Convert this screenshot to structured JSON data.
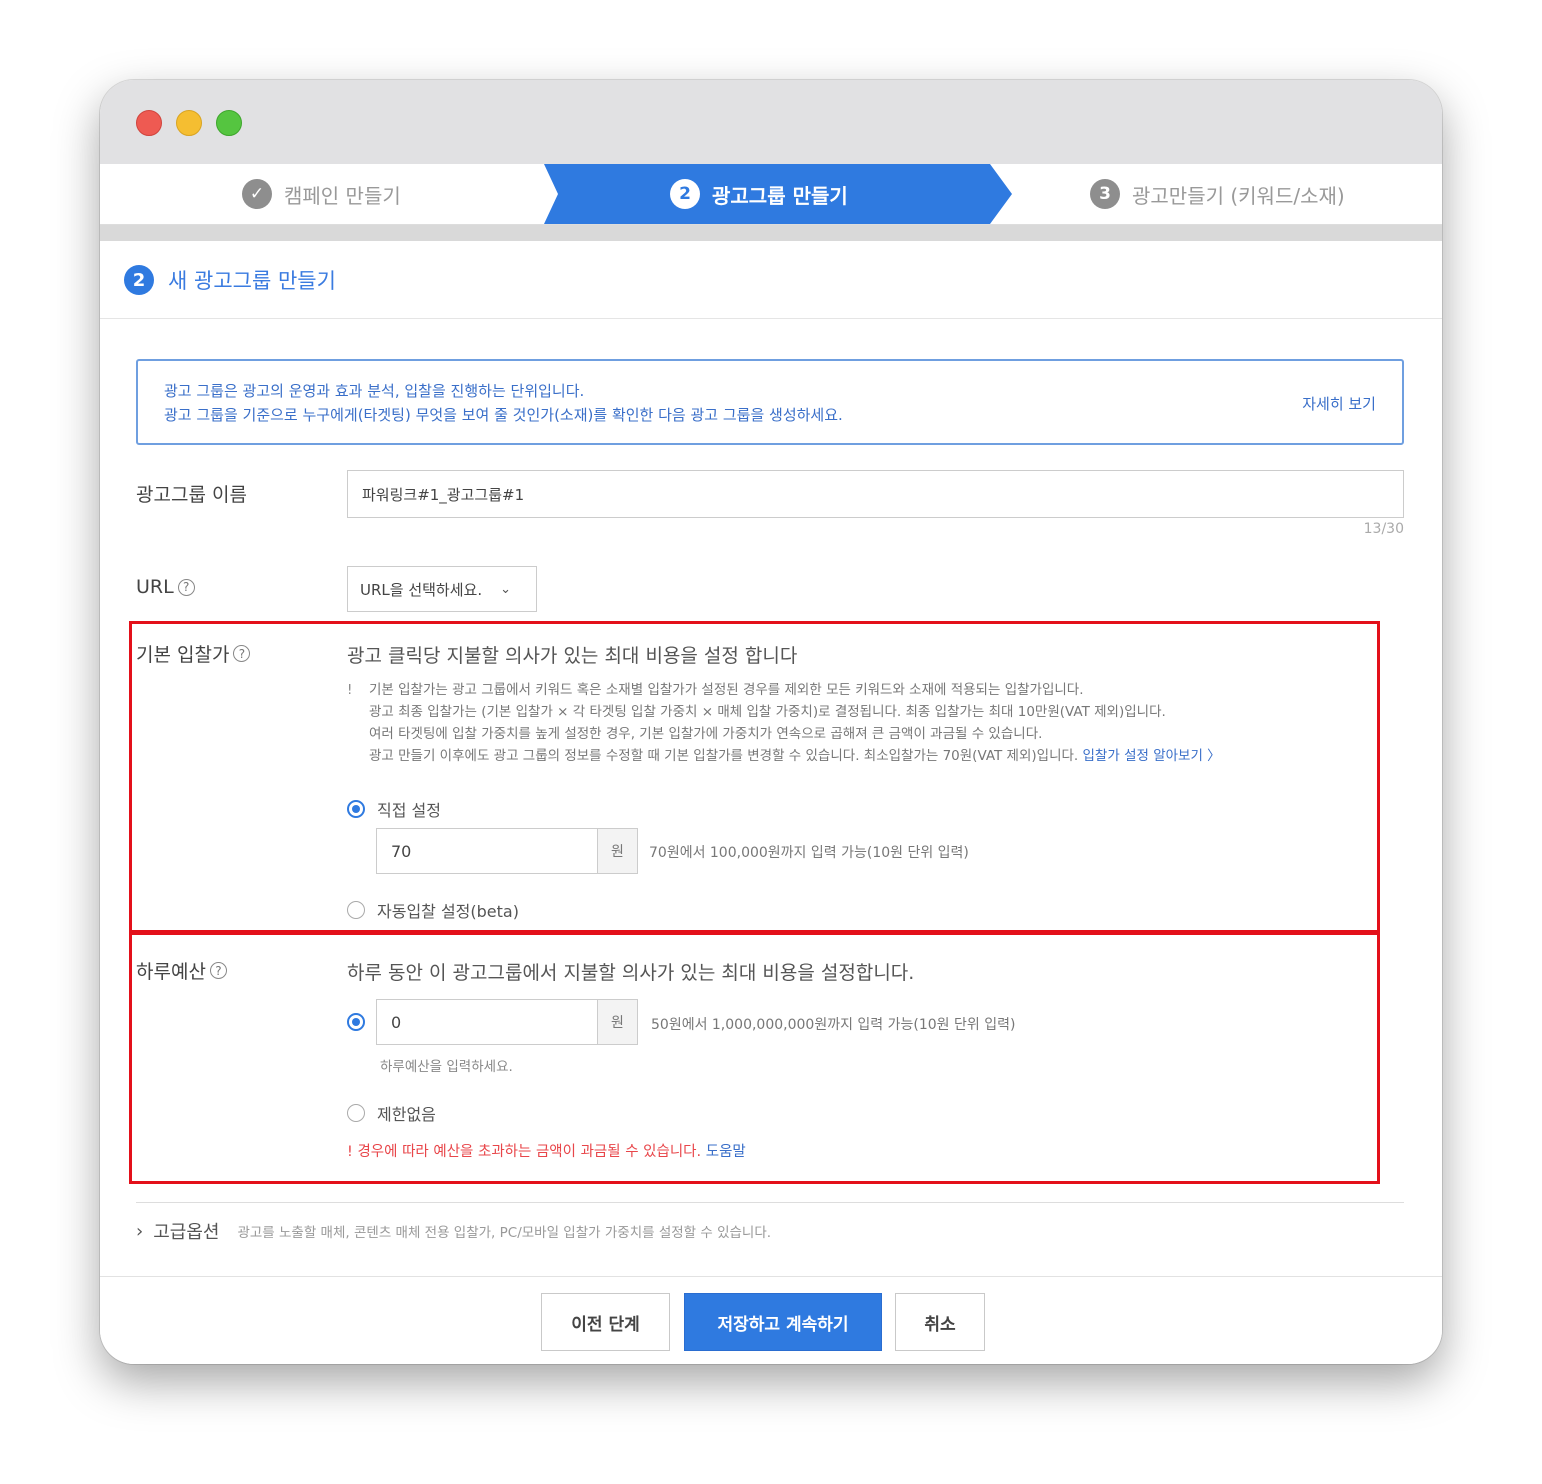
{
  "window": {
    "controls": [
      "close",
      "minimize",
      "maximize"
    ]
  },
  "steps": [
    {
      "label": "캠페인 만들기",
      "icon": "check-icon",
      "state": "done"
    },
    {
      "label": "광고그룹 만들기",
      "number": "2",
      "state": "active"
    },
    {
      "label": "광고만들기 (키워드/소재)",
      "number": "3",
      "state": "pending"
    }
  ],
  "section": {
    "number": "2",
    "title": "새 광고그룹 만들기"
  },
  "info": {
    "line1": "광고 그룹은 광고의 운영과 효과 분석, 입찰을 진행하는 단위입니다.",
    "line2": "광고 그룹을 기준으로 누구에게(타겟팅) 무엇을 보여 줄 것인가(소재)를 확인한 다음 광고 그룹을 생성하세요.",
    "more_link": "자세히 보기"
  },
  "adgroup_name": {
    "label": "광고그룹 이름",
    "value": "파워링크#1_광고그룹#1",
    "counter": "13/30"
  },
  "url": {
    "label": "URL",
    "help": "?",
    "selected": "URL을 선택하세요.",
    "chevron": "⌄"
  },
  "bid": {
    "label": "기본 입찰가",
    "help": "?",
    "description": "광고 클릭당 지불할 의사가 있는 최대 비용을 설정 합니다",
    "note_icon": "!",
    "notes": [
      "기본 입찰가는 광고 그룹에서 키워드 혹은 소재별 입찰가가 설정된 경우를 제외한 모든 키워드와 소재에 적용되는 입찰가입니다.",
      "광고 최종 입찰가는 (기본 입찰가 × 각 타겟팅 입찰 가중치 × 매체 입찰 가중치)로 결정됩니다. 최종 입찰가는 최대 10만원(VAT 제외)입니다.",
      "여러 타겟팅에 입찰 가중치를 높게 설정한 경우, 기본 입찰가에 가중치가 연속으로 곱해져 큰 금액이 과금될 수 있습니다.",
      "광고 만들기 이후에도 광고 그룹의 정보를 수정할 때 기본 입찰가를 변경할 수 있습니다. 최소입찰가는 70원(VAT 제외)입니다."
    ],
    "note_link": "입찰가 설정 알아보기 〉",
    "option_manual": "직접 설정",
    "value": "70",
    "unit": "원",
    "range_hint": "70원에서 100,000원까지 입력 가능(10원 단위 입력)",
    "option_auto": "자동입찰 설정(beta)"
  },
  "budget": {
    "label": "하루예산",
    "help": "?",
    "description": "하루 동안 이 광고그룹에서 지불할 의사가 있는 최대 비용을 설정합니다.",
    "value": "0",
    "unit": "원",
    "range_hint": "50원에서 1,000,000,000원까지 입력 가능(10원 단위 입력)",
    "sub_hint": "하루예산을 입력하세요.",
    "option_unlimited": "제한없음",
    "warn_icon": "!",
    "warning": "경우에 따라 예산을 초과하는 금액이 과금될 수 있습니다.",
    "warning_link": "도움말"
  },
  "advanced": {
    "label": "고급옵션",
    "chevron": "›",
    "description": "광고를 노출할 매체, 콘텐츠 매체 전용 입찰가, PC/모바일 입찰가 가중치를 설정할 수 있습니다."
  },
  "footer": {
    "prev": "이전 단계",
    "save": "저장하고 계속하기",
    "cancel": "취소"
  },
  "colors": {
    "accent": "#2f7ae0",
    "highlight_box": "#e3101a",
    "warning": "#e8464a"
  }
}
